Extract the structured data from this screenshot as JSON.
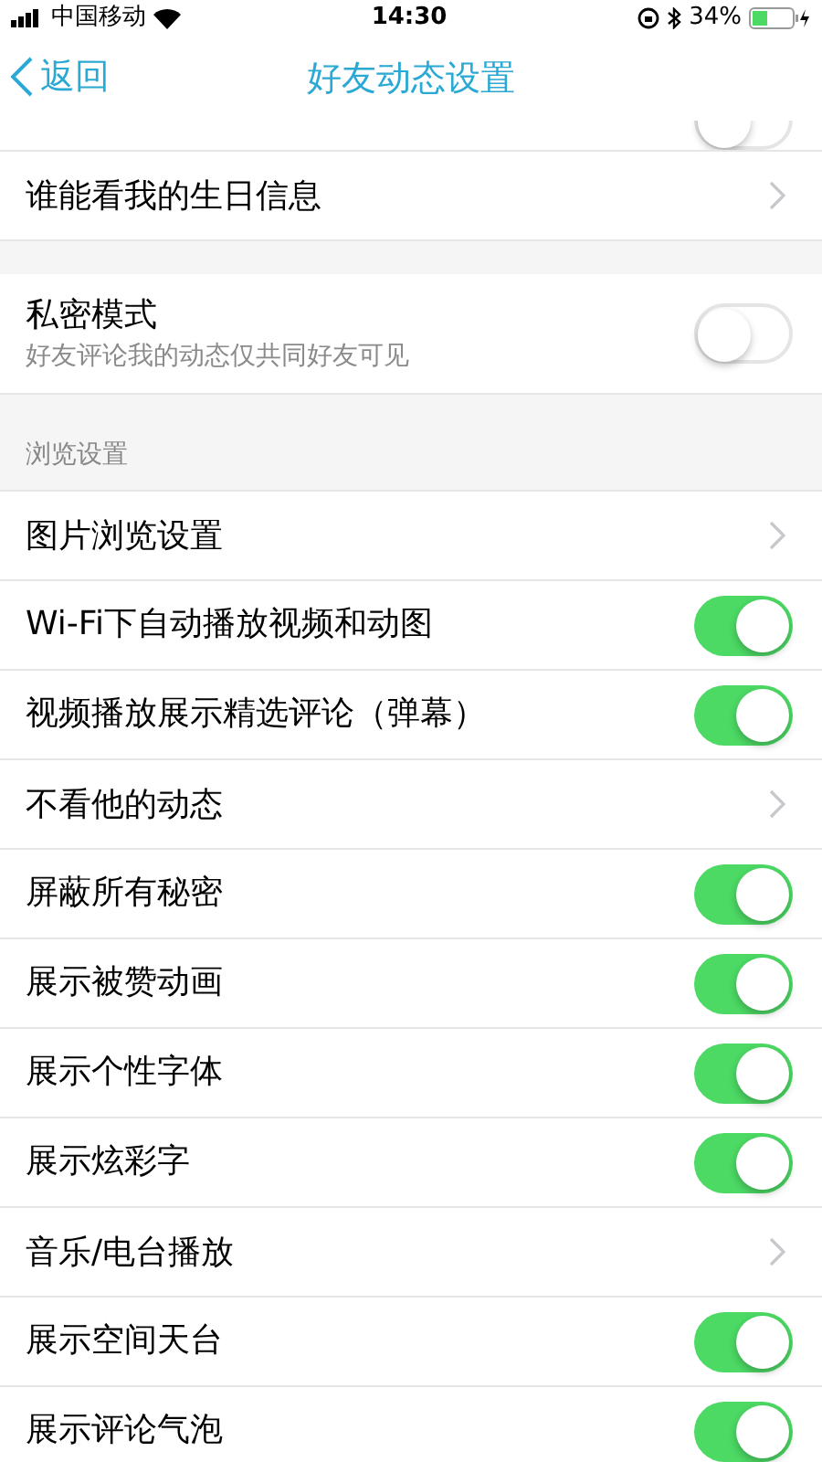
{
  "status_bar": {
    "carrier": "中国移动",
    "time": "14:30",
    "battery": "34%"
  },
  "nav": {
    "back": "返回",
    "title": "好友动态设置"
  },
  "sections": [
    {
      "rows": [
        {
          "kind": "partial",
          "on": false
        },
        {
          "kind": "link",
          "label": "谁能看我的生日信息"
        }
      ]
    },
    {
      "rows": [
        {
          "kind": "toggle",
          "label": "私密模式",
          "subtitle": "好友评论我的动态仅共同好友可见",
          "on": false
        }
      ]
    },
    {
      "header": "浏览设置",
      "rows": [
        {
          "kind": "link",
          "label": "图片浏览设置"
        },
        {
          "kind": "toggle",
          "label": "Wi-Fi下自动播放视频和动图",
          "on": true
        },
        {
          "kind": "toggle",
          "label": "视频播放展示精选评论（弹幕）",
          "on": true
        },
        {
          "kind": "link",
          "label": "不看他的动态"
        },
        {
          "kind": "toggle",
          "label": "屏蔽所有秘密",
          "on": true
        },
        {
          "kind": "toggle",
          "label": "展示被赞动画",
          "on": true
        },
        {
          "kind": "toggle",
          "label": "展示个性字体",
          "on": true
        },
        {
          "kind": "toggle",
          "label": "展示炫彩字",
          "on": true
        },
        {
          "kind": "link",
          "label": "音乐/电台播放"
        },
        {
          "kind": "toggle",
          "label": "展示空间天台",
          "on": true
        },
        {
          "kind": "toggle",
          "label": "展示评论气泡",
          "on": true
        }
      ]
    }
  ]
}
